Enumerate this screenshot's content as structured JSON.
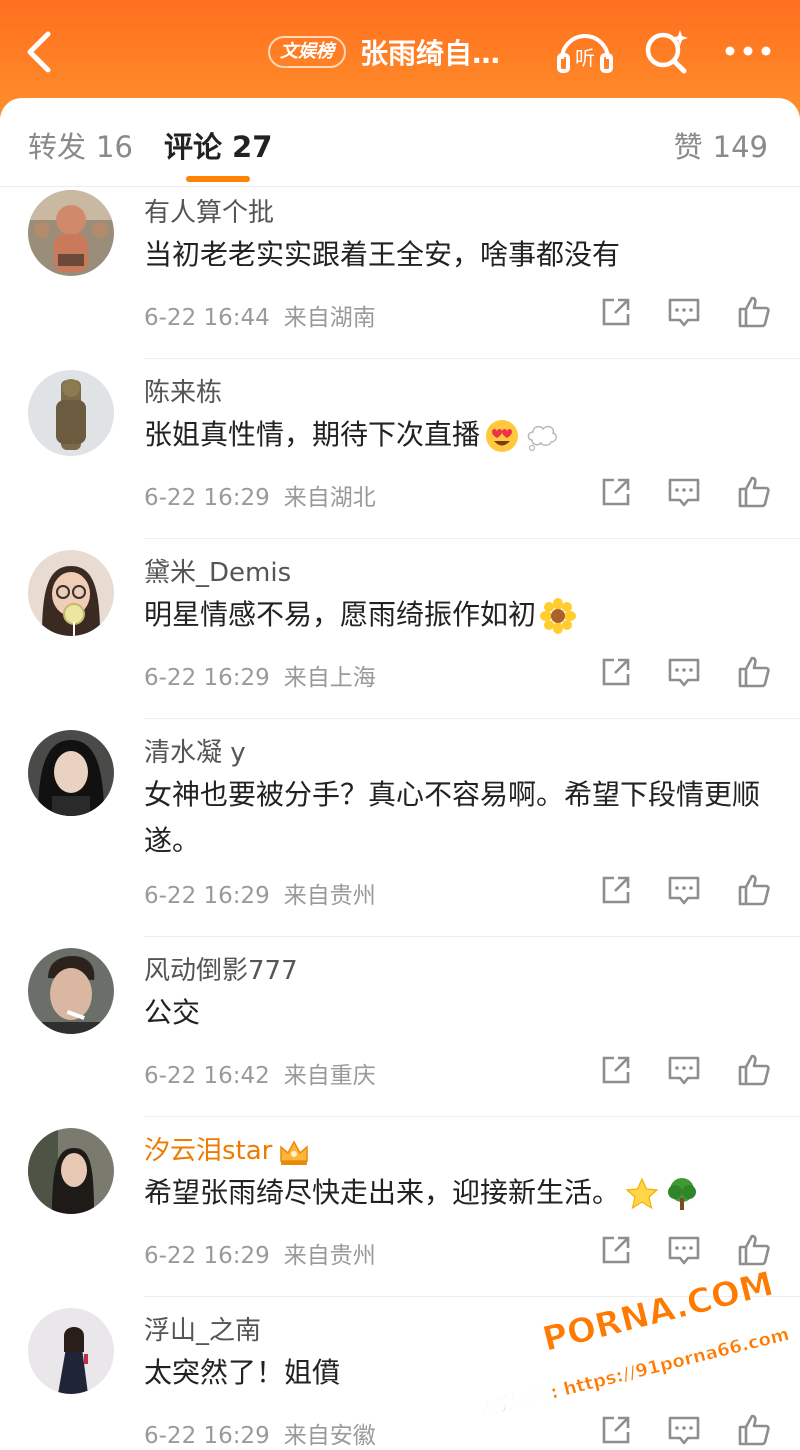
{
  "header": {
    "badge": "文娱榜",
    "title": "张雨绮自…",
    "listen_label": "听"
  },
  "tabs": {
    "repost_label": "转发",
    "repost_count": "16",
    "comment_label": "评论",
    "comment_count": "27",
    "like_label": "赞",
    "like_count": "149"
  },
  "comments": [
    {
      "user": "有人算个批",
      "text": "当初老老实实跟着王全安，啥事都没有",
      "time": "6-22 16:44",
      "source": "来自湖南"
    },
    {
      "user": "陈来栋",
      "text": "张姐真性情，期待下次直播",
      "time": "6-22 16:29",
      "source": "来自湖北",
      "emojis": [
        "heart-eyes-emoji",
        "thought-bubble-emoji"
      ]
    },
    {
      "user": "黛米_Demis",
      "text": "明星情感不易，愿雨绮振作如初",
      "time": "6-22 16:29",
      "source": "来自上海",
      "emojis": [
        "sunflower-emoji"
      ]
    },
    {
      "user": "清水凝 y",
      "text": "女神也要被分手？真心不容易啊。希望下段情更顺遂。",
      "time": "6-22 16:29",
      "source": "来自贵州"
    },
    {
      "user": "风动倒影777",
      "text": "公交",
      "time": "6-22 16:42",
      "source": "来自重庆"
    },
    {
      "user": "汐云泪star",
      "vip": true,
      "text": "希望张雨绮尽快走出来，迎接新生活。",
      "time": "6-22 16:29",
      "source": "来自贵州",
      "emojis": [
        "star-emoji",
        "tree-emoji"
      ]
    },
    {
      "user": "浮山_之南",
      "text": "太突然了！姐僨",
      "time": "6-22 16:29",
      "source": "来自安徽"
    }
  ],
  "watermark": {
    "main": "PORNA.COM",
    "sub": "看完整版: https://91porna66.com"
  },
  "colors": {
    "brand_orange": "#ff8200",
    "header_top": "#ff6f1e",
    "vip_name": "#f07a00"
  }
}
